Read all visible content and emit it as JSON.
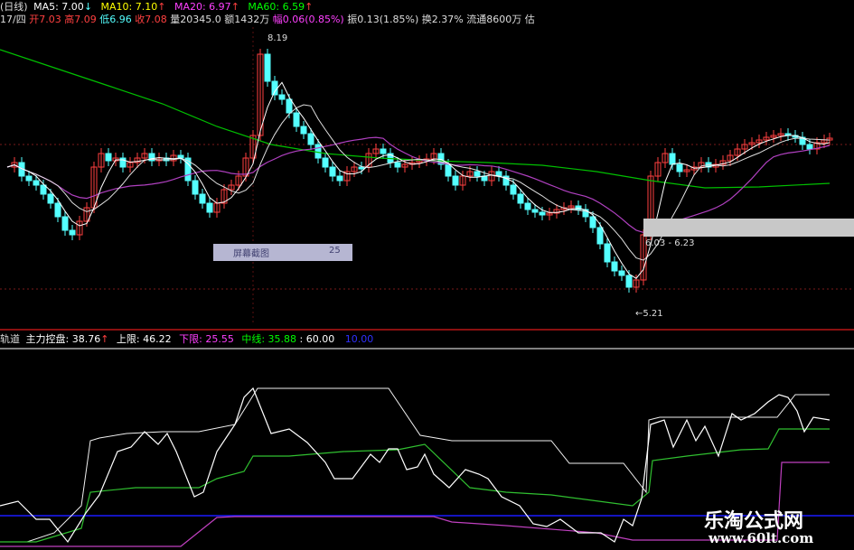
{
  "header": {
    "period": "(日线)",
    "ma5": "MA5: 7.00",
    "ma5_arrow": "↓",
    "ma10": "MA10: 7.10",
    "ma10_arrow": "↑",
    "ma20": "MA20: 6.97",
    "ma20_arrow": "↑",
    "ma60": "MA60: 6.59",
    "ma60_arrow": "↑"
  },
  "quote": {
    "date": "17/四",
    "open": "开7.03",
    "high": "高7.09",
    "low": "低6.96",
    "close": "收7.08",
    "volume": "量20345.0",
    "amount": "额1432万",
    "change": "幅0.06(0.85%)",
    "amplitude": "振0.13(1.85%)",
    "turnover": "换2.37%",
    "float": "流通8600万 估"
  },
  "annotations": {
    "high_price": "8.19",
    "low_price": "←5.21",
    "range_label": "6.03 - 6.23",
    "overlay_text": "屏幕截图",
    "overlay_num": "25"
  },
  "indicator": {
    "name": "轨道",
    "main_label": "主力控盘: 38.76",
    "main_arrow": "↑",
    "upper": "上限: 46.22",
    "lower": "下限: 25.55",
    "mid": "中线: 35.88",
    "const60": ": 60.00",
    "const10": "10.00"
  },
  "watermark": {
    "name": "乐淘公式网",
    "url": "www.60lt.com"
  },
  "colors": {
    "up": "#ff4040",
    "down": "#54ffff",
    "ma5": "#ffffff",
    "ma10": "#ffff00",
    "ma20": "#ff40ff",
    "ma60": "#00ff00",
    "upper": "#ffffff",
    "lower": "#ff40ff",
    "mid": "#00ff00",
    "const60": "#ffffff",
    "const10": "#0000ff"
  }
}
